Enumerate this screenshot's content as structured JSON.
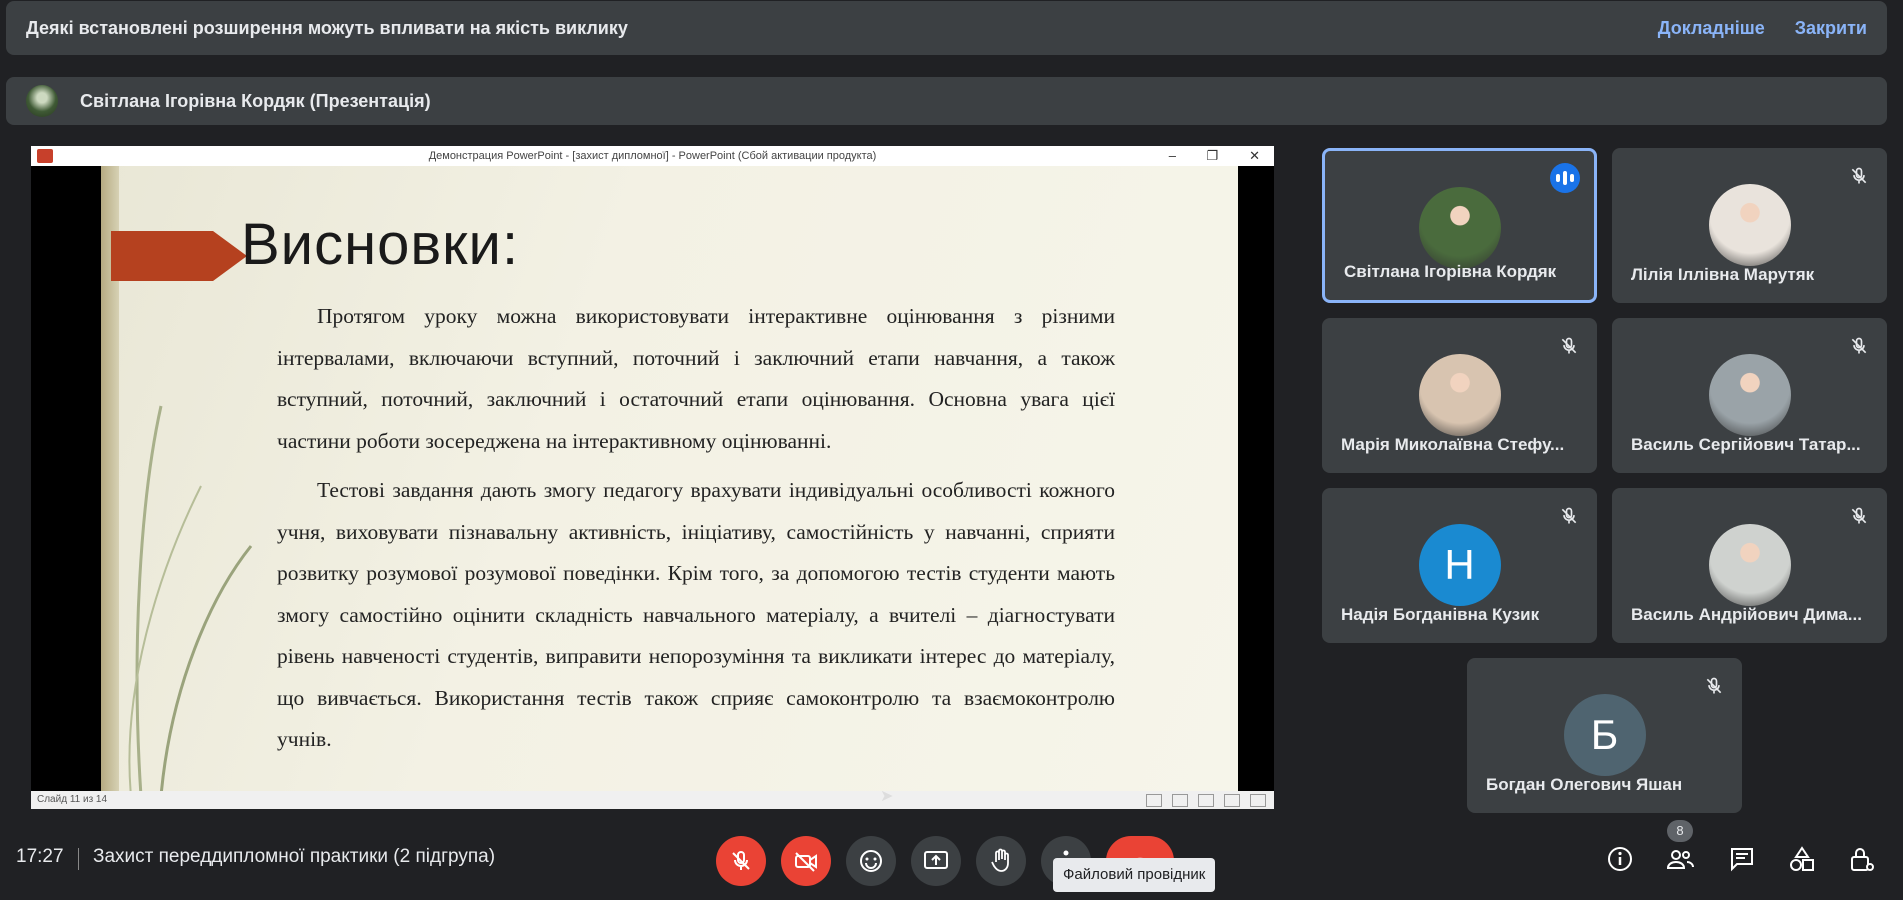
{
  "banner": {
    "text": "Деякі встановлені розширення можуть впливати на якість виклику",
    "learn_more": "Докладніше",
    "close": "Закрити"
  },
  "presenter": {
    "name": "Світлана Ігорівна Кордяк (Презентація)"
  },
  "shared_screen": {
    "window_title": "Демонстрация PowerPoint - [захист дипломної] - PowerPoint (Сбой активации продукта)",
    "slide_heading": "Висновки:",
    "paragraph_1": "Протягом уроку можна використовувати інтерактивне оцінювання з різними інтервалами, включаючи вступний, поточний і заключний етапи навчання, а також вступний, поточний, заключний і остаточний етапи оцінювання. Основна увага цієї частини роботи зосереджена на інтерактивному оцінюванні.",
    "paragraph_2": "Тестові завдання дають змогу педагогу врахувати індивідуальні особливості кожного учня, виховувати пізнавальну активність, ініціативу, самостійність у навчанні, сприяти розвитку розумової розумової поведінки. Крім того, за допомогою тестів студенти мають змогу самостійно оцінити складність навчального матеріалу, а вчителі – діагностувати рівень навченості студентів, виправити непорозуміння та викликати інтерес до матеріалу, що вивчається. Використання тестів також сприяє самоконтролю та взаємоконтролю учнів.",
    "status": "Слайд 11 из 14"
  },
  "participants": [
    {
      "name": "Світлана Ігорівна Кордяк",
      "initial": "",
      "avatar_color": "#4a6b3d",
      "speaking": true
    },
    {
      "name": "Лілія Іллівна Марутяк",
      "initial": "",
      "avatar_color": "#e9e3dc",
      "speaking": false
    },
    {
      "name": "Марія Миколаївна Стефу...",
      "initial": "",
      "avatar_color": "#d8c4b0",
      "speaking": false
    },
    {
      "name": "Василь Сергійович Татар...",
      "initial": "",
      "avatar_color": "#9aa3a8",
      "speaking": false
    },
    {
      "name": "Надія Богданівна Кузик",
      "initial": "Н",
      "avatar_color": "#1a8ad1",
      "speaking": false
    },
    {
      "name": "Василь Андрійович Дима...",
      "initial": "",
      "avatar_color": "#cfd2cf",
      "speaking": false
    },
    {
      "name": "Богдан Олегович Яшан",
      "initial": "Б",
      "avatar_color": "#4f6470",
      "speaking": false
    }
  ],
  "bottom_bar": {
    "time": "17:27",
    "meeting_title": "Захист переддипломної практики (2 підгрупа)",
    "tooltip": "Файловий провідник",
    "participant_count": "8"
  },
  "icons": [
    "mic-off-icon",
    "camera-off-icon",
    "emoji-icon",
    "present-icon",
    "raise-hand-icon",
    "more-options-icon",
    "end-call-icon",
    "info-icon",
    "people-icon",
    "chat-icon",
    "activities-icon",
    "host-controls-icon"
  ]
}
